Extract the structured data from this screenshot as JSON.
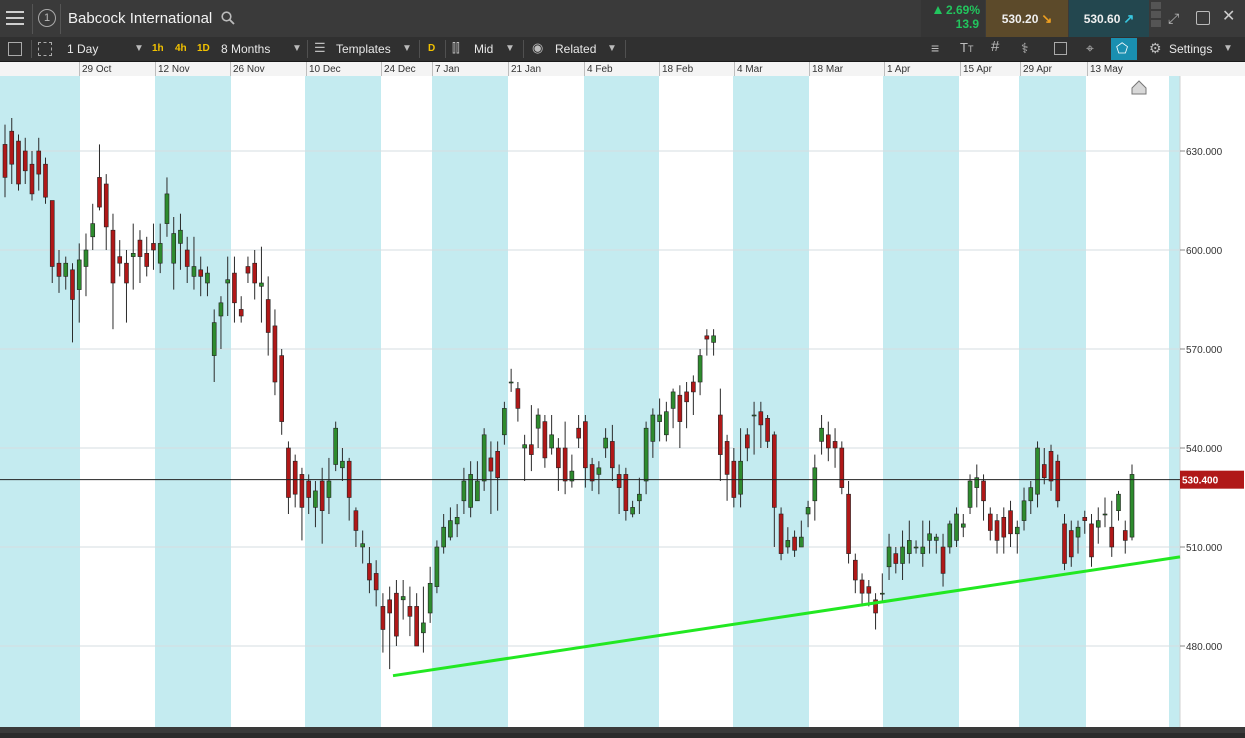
{
  "header": {
    "instrument": "Babcock International",
    "info_icon": "info-circle-icon",
    "change_pct": "2.69%",
    "change_abs": "13.9",
    "sell_price": "530.20",
    "buy_price": "530.60",
    "colors": {
      "up": "#22c55e",
      "sell_bg": "#5c4a2a",
      "buy_bg": "#23474f"
    }
  },
  "toolbar": {
    "interval": "1 Day",
    "quick_intervals": [
      "1h",
      "4h",
      "1D"
    ],
    "period": "8 Months",
    "templates_label": "Templates",
    "d_badge": "D",
    "price_type": "Mid",
    "related_label": "Related",
    "settings_label": "Settings"
  },
  "chart_data": {
    "type": "candlestick",
    "title": "",
    "xlabel": "",
    "ylabel": "",
    "ylim": [
      460,
      640
    ],
    "y_ticks": [
      480,
      510,
      540,
      570,
      600,
      630
    ],
    "y_tick_labels": [
      "480.000",
      "510.000",
      "540.000",
      "570.000",
      "600.000",
      "630.000"
    ],
    "current_price_label": "530.400",
    "current_price": 530.4,
    "x_tick_labels": [
      "29 Oct",
      "12 Nov",
      "26 Nov",
      "10 Dec",
      "24 Dec",
      "7 Jan",
      "21 Jan",
      "4 Feb",
      "18 Feb",
      "4 Mar",
      "18 Mar",
      "1 Apr",
      "15 Apr",
      "29 Apr",
      "13 May"
    ],
    "colors": {
      "up": "#2e8b2e",
      "down": "#b01818",
      "trendline": "#22e822",
      "band": "#c4ebf0"
    },
    "candles": [
      [
        632,
        622,
        638,
        616
      ],
      [
        636,
        626,
        640,
        620
      ],
      [
        633,
        620,
        635,
        618
      ],
      [
        630,
        624,
        634,
        620
      ],
      [
        626,
        617,
        630,
        615
      ],
      [
        630,
        623,
        634,
        618
      ],
      [
        626,
        616,
        628,
        614
      ],
      [
        615,
        595,
        615,
        590
      ],
      [
        596,
        592,
        600,
        587
      ],
      [
        592,
        596,
        598,
        588
      ],
      [
        594,
        585,
        596,
        572
      ],
      [
        588,
        597,
        602,
        578
      ],
      [
        595,
        600,
        605,
        586
      ],
      [
        604,
        608,
        614,
        600
      ],
      [
        622,
        613,
        632,
        612
      ],
      [
        620,
        607,
        623,
        600
      ],
      [
        606,
        590,
        611,
        576
      ],
      [
        598,
        596,
        603,
        592
      ],
      [
        596,
        590,
        600,
        578
      ],
      [
        598,
        599,
        608,
        588
      ],
      [
        603,
        598,
        606,
        590
      ],
      [
        599,
        595,
        604,
        592
      ],
      [
        602,
        600,
        608,
        594
      ],
      [
        596,
        602,
        608,
        593
      ],
      [
        608,
        617,
        622,
        604
      ],
      [
        596,
        605,
        610,
        588
      ],
      [
        602,
        606,
        611,
        594
      ],
      [
        600,
        595,
        604,
        590
      ],
      [
        592,
        595,
        604,
        588
      ],
      [
        594,
        592,
        598,
        586
      ],
      [
        590,
        593,
        595,
        586
      ],
      [
        568,
        578,
        582,
        560
      ],
      [
        580,
        584,
        586,
        570
      ],
      [
        590,
        591,
        598,
        580
      ],
      [
        593,
        584,
        598,
        578
      ],
      [
        582,
        580,
        586,
        578
      ],
      [
        595,
        593,
        598,
        590
      ],
      [
        596,
        590,
        600,
        585
      ],
      [
        589,
        590,
        601,
        578
      ],
      [
        585,
        575,
        592,
        568
      ],
      [
        577,
        560,
        582,
        556
      ],
      [
        568,
        548,
        570,
        544
      ],
      [
        540,
        525,
        542,
        520
      ],
      [
        536,
        526,
        538,
        522
      ],
      [
        532,
        522,
        534,
        512
      ],
      [
        530,
        525,
        532,
        520
      ],
      [
        522,
        527,
        530,
        516
      ],
      [
        530,
        521,
        534,
        511
      ],
      [
        525,
        530,
        537,
        520
      ],
      [
        535,
        546,
        548,
        533
      ],
      [
        534,
        536,
        540,
        530
      ],
      [
        536,
        525,
        537,
        518
      ],
      [
        521,
        515,
        522,
        510
      ],
      [
        510,
        511,
        515,
        505
      ],
      [
        505,
        500,
        510,
        496
      ],
      [
        502,
        497,
        506,
        492
      ],
      [
        492,
        485,
        496,
        478
      ],
      [
        494,
        490,
        498,
        473
      ],
      [
        496,
        483,
        500,
        480
      ],
      [
        494,
        495,
        500,
        488
      ],
      [
        492,
        489,
        498,
        483
      ],
      [
        492,
        480,
        496,
        480
      ],
      [
        484,
        487,
        498,
        478
      ],
      [
        490,
        499,
        504,
        487
      ],
      [
        498,
        510,
        512,
        496
      ],
      [
        510,
        516,
        520,
        508
      ],
      [
        513,
        518,
        522,
        512
      ],
      [
        517,
        519,
        523,
        513
      ],
      [
        524,
        530,
        534,
        520
      ],
      [
        522,
        532,
        536,
        519
      ],
      [
        524,
        530,
        536,
        524
      ],
      [
        530,
        544,
        546,
        527
      ],
      [
        537,
        533,
        542,
        520
      ],
      [
        539,
        531,
        542,
        521
      ],
      [
        544,
        552,
        554,
        541
      ],
      [
        560,
        560,
        564,
        557
      ],
      [
        558,
        552,
        560,
        548
      ],
      [
        540,
        541,
        544,
        530
      ],
      [
        541,
        538,
        553,
        533
      ],
      [
        546,
        550,
        552,
        540
      ],
      [
        548,
        537,
        550,
        534
      ],
      [
        540,
        544,
        550,
        538
      ],
      [
        540,
        534,
        543,
        527
      ],
      [
        540,
        530,
        548,
        526
      ],
      [
        530,
        533,
        538,
        528
      ],
      [
        546,
        543,
        550,
        540
      ],
      [
        548,
        534,
        550,
        528
      ],
      [
        535,
        530,
        537,
        527
      ],
      [
        532,
        534,
        536,
        526
      ],
      [
        540,
        543,
        546,
        537
      ],
      [
        542,
        534,
        547,
        530
      ],
      [
        532,
        528,
        535,
        520
      ],
      [
        532,
        521,
        534,
        518
      ],
      [
        520,
        522,
        524,
        519
      ],
      [
        524,
        526,
        531,
        520
      ],
      [
        530,
        546,
        548,
        526
      ],
      [
        542,
        550,
        552,
        537
      ],
      [
        548,
        550,
        555,
        542
      ],
      [
        544,
        551,
        554,
        542
      ],
      [
        552,
        557,
        558,
        546
      ],
      [
        556,
        548,
        559,
        540
      ],
      [
        557,
        554,
        560,
        546
      ],
      [
        560,
        557,
        562,
        550
      ],
      [
        560,
        568,
        570,
        556
      ],
      [
        574,
        573,
        576,
        568
      ],
      [
        572,
        574,
        576,
        568
      ],
      [
        550,
        538,
        558,
        530
      ],
      [
        542,
        532,
        544,
        524
      ],
      [
        536,
        525,
        540,
        522
      ],
      [
        526,
        536,
        546,
        522
      ],
      [
        544,
        540,
        546,
        536
      ],
      [
        550,
        550,
        554,
        538
      ],
      [
        551,
        547,
        554,
        540
      ],
      [
        549,
        542,
        550,
        540
      ],
      [
        544,
        522,
        545,
        510
      ],
      [
        520,
        508,
        522,
        506
      ],
      [
        510,
        512,
        516,
        508
      ],
      [
        513,
        509,
        515,
        507
      ],
      [
        510,
        513,
        518,
        510
      ],
      [
        520,
        522,
        524,
        516
      ],
      [
        524,
        534,
        538,
        518
      ],
      [
        542,
        546,
        550,
        538
      ],
      [
        544,
        540,
        548,
        536
      ],
      [
        542,
        540,
        546,
        534
      ],
      [
        540,
        528,
        542,
        526
      ],
      [
        526,
        508,
        530,
        505
      ],
      [
        506,
        500,
        508,
        496
      ],
      [
        500,
        496,
        502,
        492
      ],
      [
        498,
        496,
        500,
        492
      ],
      [
        494,
        490,
        496,
        485
      ],
      [
        496,
        496,
        502,
        493
      ],
      [
        504,
        510,
        514,
        500
      ],
      [
        508,
        505,
        510,
        502
      ],
      [
        505,
        510,
        515,
        500
      ],
      [
        508,
        512,
        518,
        505
      ],
      [
        510,
        510,
        512,
        508
      ],
      [
        508,
        510,
        518,
        504
      ],
      [
        512,
        514,
        518,
        508
      ],
      [
        512,
        513,
        514,
        508
      ],
      [
        510,
        502,
        514,
        498
      ],
      [
        510,
        517,
        518,
        508
      ],
      [
        512,
        520,
        522,
        510
      ],
      [
        516,
        517,
        520,
        513
      ],
      [
        522,
        530,
        532,
        520
      ],
      [
        528,
        531,
        535,
        522
      ],
      [
        530,
        524,
        532,
        518
      ],
      [
        520,
        515,
        522,
        512
      ],
      [
        518,
        512,
        520,
        508
      ],
      [
        519,
        513,
        522,
        508
      ],
      [
        521,
        514,
        524,
        510
      ],
      [
        514,
        516,
        518,
        508
      ],
      [
        518,
        524,
        528,
        515
      ],
      [
        524,
        528,
        530,
        520
      ],
      [
        526,
        540,
        542,
        522
      ],
      [
        535,
        531,
        540,
        529
      ],
      [
        539,
        530,
        541,
        527
      ],
      [
        536,
        524,
        538,
        522
      ],
      [
        517,
        505,
        520,
        503
      ],
      [
        515,
        507,
        518,
        504
      ],
      [
        513,
        516,
        518,
        508
      ],
      [
        519,
        518,
        521,
        514
      ],
      [
        517,
        507,
        520,
        504
      ],
      [
        516,
        518,
        522,
        511
      ],
      [
        520,
        520,
        525,
        516
      ],
      [
        516,
        510,
        524,
        507
      ],
      [
        521,
        526,
        527,
        518
      ],
      [
        515,
        512,
        518,
        508
      ],
      [
        513,
        532,
        535,
        512
      ]
    ],
    "trendline": [
      [
        486,
        471
      ],
      [
        1180,
        507
      ]
    ]
  },
  "right_toolbar_icons": [
    "layout-icon",
    "text-size-icon",
    "grid-icon",
    "indicator-icon",
    "compare-icon",
    "crosshair-icon",
    "draw-icon",
    "gear-icon"
  ]
}
